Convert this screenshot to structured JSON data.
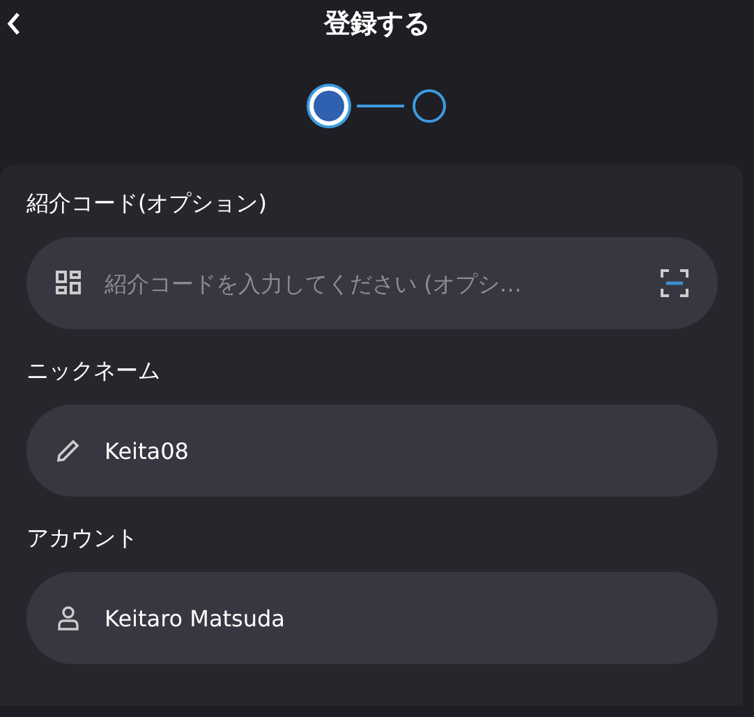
{
  "header": {
    "title": "登録する"
  },
  "steps": [
    {
      "selected": true
    },
    {
      "selected": false
    }
  ],
  "fields": [
    {
      "label": "紹介コード(オプション)",
      "kind": "code",
      "placeholder": "紹介コードを入力してください (オプシ…"
    },
    {
      "label": "ニックネーム",
      "kind": "edit",
      "value": "Keita08"
    },
    {
      "label": "アカウント",
      "kind": "account",
      "value": "Keitaro Matsuda"
    }
  ]
}
